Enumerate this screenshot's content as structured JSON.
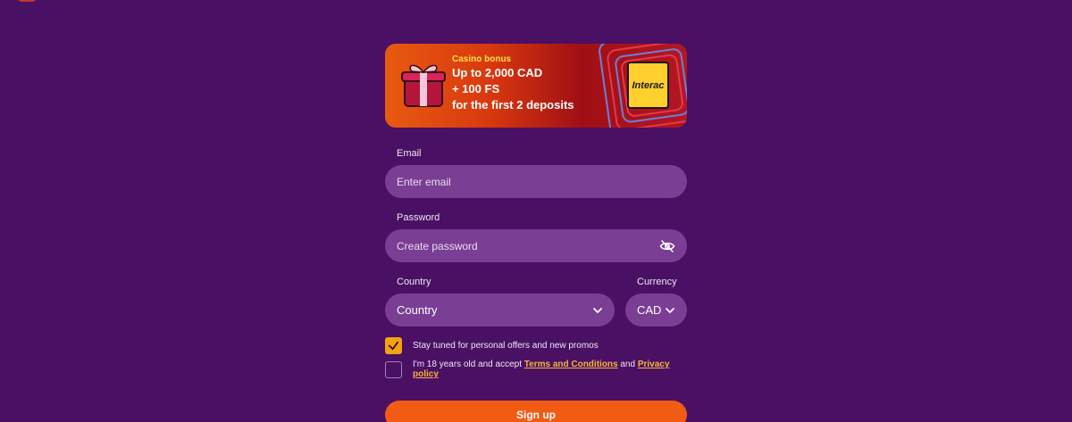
{
  "banner": {
    "kicker": "Casino bonus",
    "line1": "Up to 2,000 CAD",
    "line2": "+ 100 FS",
    "line3": "for the first 2 deposits",
    "payment_logo": "Interac"
  },
  "form": {
    "email": {
      "label": "Email",
      "placeholder": "Enter email"
    },
    "password": {
      "label": "Password",
      "placeholder": "Create password",
      "icon": "eye-off-icon"
    },
    "country": {
      "label": "Country",
      "value": "Country"
    },
    "currency": {
      "label": "Currency",
      "value": "CAD"
    },
    "offers_checkbox": {
      "label": "Stay tuned for personal offers and new promos",
      "checked": true
    },
    "terms_checkbox": {
      "prefix": "I'm 18 years old and accept",
      "terms_link": "Terms and Conditions",
      "and": "and",
      "privacy_link": "Privacy policy",
      "checked": false
    },
    "submit_label": "Sign up"
  },
  "colors": {
    "background": "#4a1064",
    "field": "#7a3e94",
    "accent": "#f25b14",
    "checkbox": "#f4a20f",
    "link": "#f8b33a"
  }
}
